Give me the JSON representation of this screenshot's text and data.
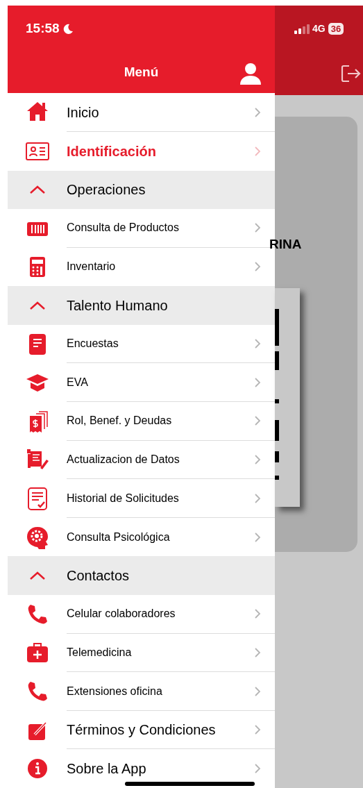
{
  "status_bar": {
    "time": "15:58",
    "network": "4G",
    "battery": "36"
  },
  "header": {
    "title": "Menú"
  },
  "menu": [
    {
      "kind": "item",
      "label": "Inicio",
      "selected": false
    },
    {
      "kind": "item",
      "label": "Identificación",
      "selected": true
    },
    {
      "kind": "section",
      "label": "Operaciones",
      "expanded": true
    },
    {
      "kind": "subitem",
      "label": "Consulta de Productos",
      "selected": false
    },
    {
      "kind": "subitem",
      "label": "Inventario",
      "selected": false
    },
    {
      "kind": "section",
      "label": "Talento Humano",
      "expanded": true
    },
    {
      "kind": "subitem",
      "label": "Encuestas",
      "selected": false
    },
    {
      "kind": "subitem",
      "label": "EVA",
      "selected": false
    },
    {
      "kind": "subitem",
      "label": "Rol, Benef. y Deudas",
      "selected": false
    },
    {
      "kind": "subitem",
      "label": "Actualizacion de Datos",
      "selected": false
    },
    {
      "kind": "subitem",
      "label": "Historial de Solicitudes",
      "selected": false
    },
    {
      "kind": "subitem",
      "label": "Consulta Psicológica",
      "selected": false
    },
    {
      "kind": "section",
      "label": "Contactos",
      "expanded": true
    },
    {
      "kind": "subitem",
      "label": "Celular colaboradores",
      "selected": false
    },
    {
      "kind": "subitem",
      "label": "Telemedicina",
      "selected": false
    },
    {
      "kind": "subitem",
      "label": "Extensiones oficina",
      "selected": false
    },
    {
      "kind": "item",
      "label": "Términos y Condiciones",
      "selected": false
    },
    {
      "kind": "item",
      "label": "Sobre la App",
      "selected": false
    }
  ],
  "background": {
    "card_text": "RINA"
  }
}
